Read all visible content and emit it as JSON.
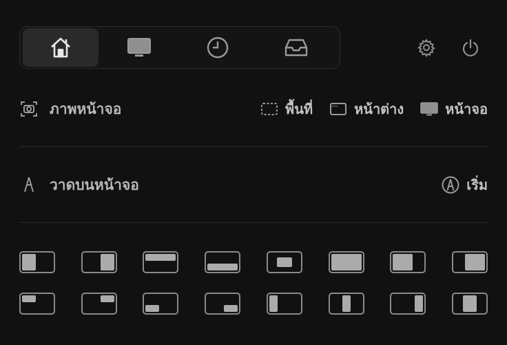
{
  "tabs": [
    {
      "name": "home",
      "icon": "home-icon",
      "active": true
    },
    {
      "name": "display",
      "icon": "monitor-icon",
      "active": false
    },
    {
      "name": "history",
      "icon": "clock-icon",
      "active": false
    },
    {
      "name": "inbox",
      "icon": "inbox-icon",
      "active": false
    }
  ],
  "utilities": [
    {
      "icon": "gear-icon"
    },
    {
      "icon": "power-icon"
    }
  ],
  "screenshot": {
    "label": "ภาพหน้าจอ",
    "icon": "camera-icon",
    "options": [
      {
        "label": "พื้นที่",
        "icon": "region-icon"
      },
      {
        "label": "หน้าต่าง",
        "icon": "window-icon"
      },
      {
        "label": "หน้าจอ",
        "icon": "monitor-icon"
      }
    ]
  },
  "draw": {
    "label": "วาดบนหน้าจอ",
    "icon": "pen-nib-icon",
    "start_label": "เริ่ม",
    "start_icon": "pen-circle-icon"
  },
  "layouts": {
    "row1": [
      "left-half",
      "right-half",
      "top-half",
      "bottom-half",
      "center",
      "maximize",
      "left-two-thirds",
      "right-two-thirds"
    ],
    "row2": [
      "top-left-quarter",
      "top-right-quarter",
      "bottom-left-quarter",
      "bottom-right-quarter",
      "left-third",
      "center-third",
      "right-third",
      "center-two-thirds"
    ]
  },
  "colors": {
    "background": "#111111",
    "active_tab": "#2a2a2a",
    "fill": "#ababab",
    "stroke": "#8a8a8a"
  }
}
